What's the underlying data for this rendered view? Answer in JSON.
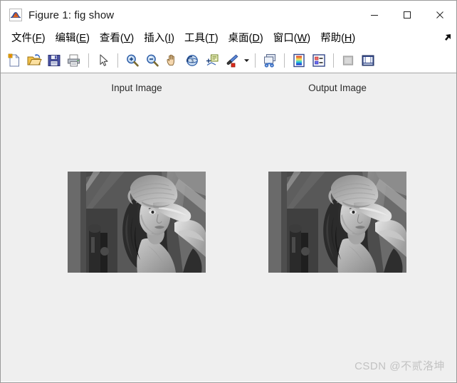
{
  "window": {
    "title": "Figure 1: fig show",
    "app_icon": "matlab-membrane-icon",
    "controls": {
      "minimize": "minimize-button",
      "maximize": "maximize-button",
      "close": "close-button"
    }
  },
  "menubar": {
    "overflow_icon": "undock-arrow-icon",
    "items": [
      {
        "label": "文件(F)",
        "text": "文件(",
        "accel": "F",
        "tail": ")"
      },
      {
        "label": "编辑(E)",
        "text": "编辑(",
        "accel": "E",
        "tail": ")"
      },
      {
        "label": "查看(V)",
        "text": "查看(",
        "accel": "V",
        "tail": ")"
      },
      {
        "label": "插入(I)",
        "text": "插入(",
        "accel": "I",
        "tail": ")"
      },
      {
        "label": "工具(T)",
        "text": "工具(",
        "accel": "T",
        "tail": ")"
      },
      {
        "label": "桌面(D)",
        "text": "桌面(",
        "accel": "D",
        "tail": ")"
      },
      {
        "label": "窗口(W)",
        "text": "窗口(",
        "accel": "W",
        "tail": ")"
      },
      {
        "label": "帮助(H)",
        "text": "帮助(",
        "accel": "H",
        "tail": ")"
      }
    ]
  },
  "toolbar": {
    "buttons": [
      {
        "name": "new-figure-icon",
        "tooltip": "New Figure"
      },
      {
        "name": "open-file-icon",
        "tooltip": "Open File"
      },
      {
        "name": "save-figure-icon",
        "tooltip": "Save Figure"
      },
      {
        "name": "print-figure-icon",
        "tooltip": "Print Figure"
      },
      {
        "name": "edit-plot-icon",
        "tooltip": "Edit Plot"
      },
      {
        "name": "zoom-in-icon",
        "tooltip": "Zoom In"
      },
      {
        "name": "zoom-out-icon",
        "tooltip": "Zoom Out"
      },
      {
        "name": "pan-icon",
        "tooltip": "Pan"
      },
      {
        "name": "rotate-3d-icon",
        "tooltip": "Rotate 3D"
      },
      {
        "name": "data-cursor-icon",
        "tooltip": "Data Cursor"
      },
      {
        "name": "brush-icon",
        "tooltip": "Brush/Select Data"
      },
      {
        "name": "link-plot-icon",
        "tooltip": "Link Plot"
      },
      {
        "name": "colorbar-icon",
        "tooltip": "Insert Colorbar"
      },
      {
        "name": "legend-icon",
        "tooltip": "Insert Legend"
      },
      {
        "name": "hide-plot-tools-icon",
        "tooltip": "Hide Plot Tools",
        "disabled": true
      },
      {
        "name": "show-plot-tools-icon",
        "tooltip": "Show Plot Tools and Dock Figure"
      }
    ]
  },
  "figure": {
    "background_color": "#efefef",
    "axes": [
      {
        "title": "Input Image",
        "image": "lena-grayscale"
      },
      {
        "title": "Output Image",
        "image": "lena-grayscale"
      }
    ]
  },
  "watermark": {
    "text": "CSDN @不贰洛坤",
    "color": "#c2c2c2"
  }
}
